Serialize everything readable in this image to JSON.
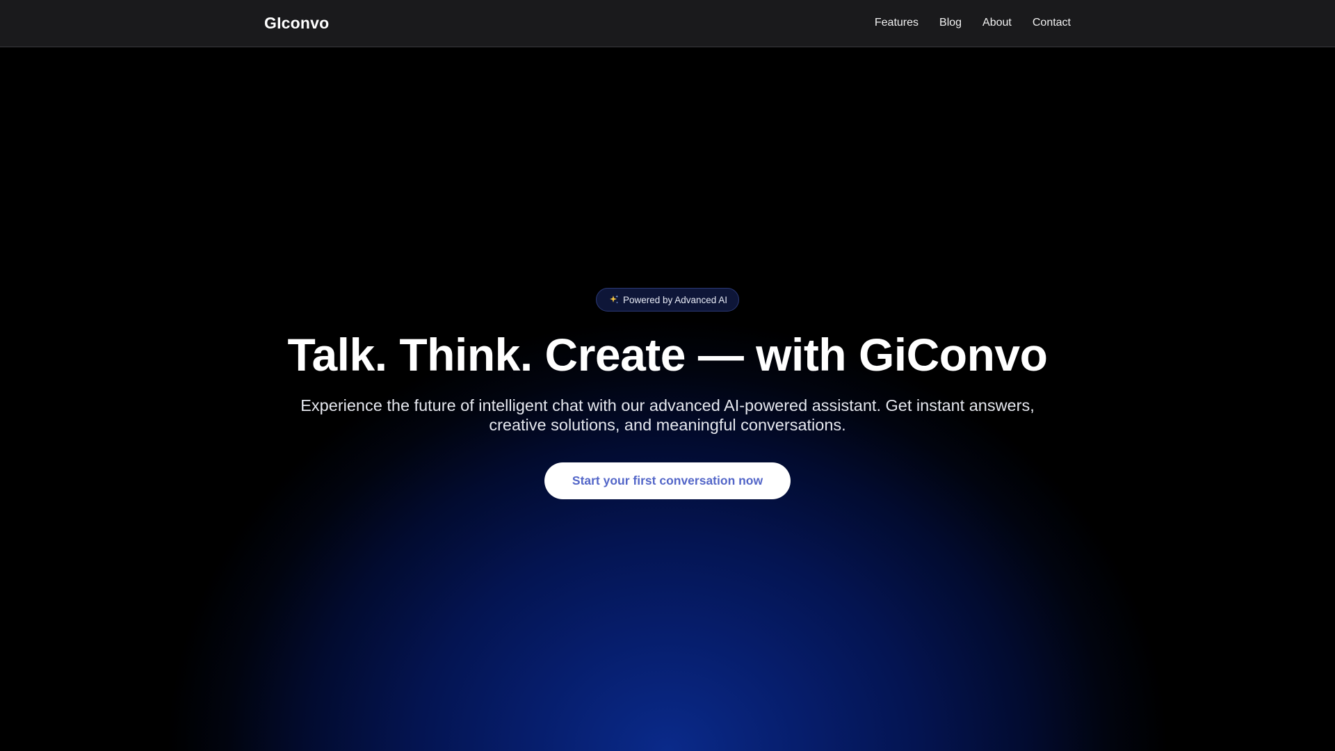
{
  "navbar": {
    "brand": "GIconvo",
    "links": [
      {
        "label": "Features"
      },
      {
        "label": "Blog"
      },
      {
        "label": "About"
      },
      {
        "label": "Contact"
      }
    ]
  },
  "hero": {
    "badge": {
      "icon": "sparkle-icon",
      "label": "Powered by Advanced AI"
    },
    "headline": "Talk. Think. Create — with GiConvo",
    "subtext": "Experience the future of intelligent chat with our advanced AI-powered assistant. Get instant answers, creative solutions, and meaningful conversations.",
    "cta_label": "Start your first conversation now"
  },
  "colors": {
    "navbar_bg": "#1a1a1c",
    "background_glow": "#0a2a8a",
    "cta_text": "#5366c8",
    "badge_bg": "#0e1638",
    "sparkle": "#f5c542"
  }
}
